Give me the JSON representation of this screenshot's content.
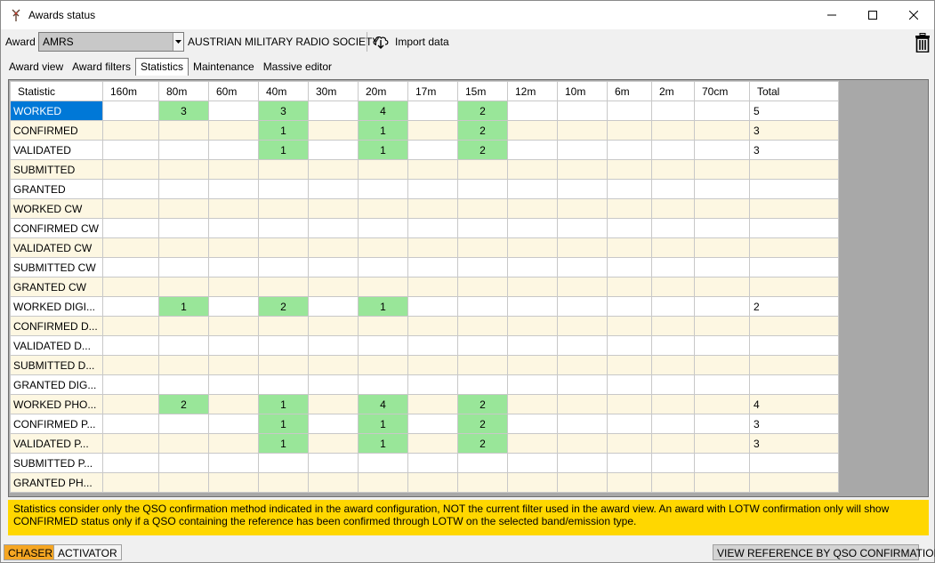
{
  "window": {
    "title": "Awards status"
  },
  "award": {
    "label": "Award",
    "selected": "AMRS",
    "name": "AUSTRIAN MILITARY RADIO SOCIETY",
    "import_label": "Import data"
  },
  "tabs": [
    {
      "label": "Award view"
    },
    {
      "label": "Award filters"
    },
    {
      "label": "Statistics",
      "active": true
    },
    {
      "label": "Maintenance"
    },
    {
      "label": "Massive editor"
    }
  ],
  "grid": {
    "columns": [
      "Statistic",
      "160m",
      "80m",
      "60m",
      "40m",
      "30m",
      "20m",
      "17m",
      "15m",
      "12m",
      "10m",
      "6m",
      "2m",
      "70cm",
      "Total"
    ],
    "rows": [
      {
        "label": "WORKED",
        "values": [
          "",
          "3",
          "",
          "3",
          "",
          "4",
          "",
          "2",
          "",
          "",
          "",
          "",
          ""
        ],
        "total": "5"
      },
      {
        "label": "CONFIRMED",
        "values": [
          "",
          "",
          "",
          "1",
          "",
          "1",
          "",
          "2",
          "",
          "",
          "",
          "",
          ""
        ],
        "total": "3"
      },
      {
        "label": "VALIDATED",
        "values": [
          "",
          "",
          "",
          "1",
          "",
          "1",
          "",
          "2",
          "",
          "",
          "",
          "",
          ""
        ],
        "total": "3"
      },
      {
        "label": "SUBMITTED",
        "values": [
          "",
          "",
          "",
          "",
          "",
          "",
          "",
          "",
          "",
          "",
          "",
          "",
          ""
        ],
        "total": ""
      },
      {
        "label": "GRANTED",
        "values": [
          "",
          "",
          "",
          "",
          "",
          "",
          "",
          "",
          "",
          "",
          "",
          "",
          ""
        ],
        "total": ""
      },
      {
        "label": "WORKED CW",
        "values": [
          "",
          "",
          "",
          "",
          "",
          "",
          "",
          "",
          "",
          "",
          "",
          "",
          ""
        ],
        "total": ""
      },
      {
        "label": "CONFIRMED CW",
        "values": [
          "",
          "",
          "",
          "",
          "",
          "",
          "",
          "",
          "",
          "",
          "",
          "",
          ""
        ],
        "total": ""
      },
      {
        "label": "VALIDATED CW",
        "values": [
          "",
          "",
          "",
          "",
          "",
          "",
          "",
          "",
          "",
          "",
          "",
          "",
          ""
        ],
        "total": ""
      },
      {
        "label": "SUBMITTED CW",
        "values": [
          "",
          "",
          "",
          "",
          "",
          "",
          "",
          "",
          "",
          "",
          "",
          "",
          ""
        ],
        "total": ""
      },
      {
        "label": "GRANTED CW",
        "values": [
          "",
          "",
          "",
          "",
          "",
          "",
          "",
          "",
          "",
          "",
          "",
          "",
          ""
        ],
        "total": ""
      },
      {
        "label": "WORKED DIGI...",
        "values": [
          "",
          "1",
          "",
          "2",
          "",
          "1",
          "",
          "",
          "",
          "",
          "",
          "",
          ""
        ],
        "total": "2"
      },
      {
        "label": "CONFIRMED D...",
        "values": [
          "",
          "",
          "",
          "",
          "",
          "",
          "",
          "",
          "",
          "",
          "",
          "",
          ""
        ],
        "total": ""
      },
      {
        "label": "VALIDATED D...",
        "values": [
          "",
          "",
          "",
          "",
          "",
          "",
          "",
          "",
          "",
          "",
          "",
          "",
          ""
        ],
        "total": ""
      },
      {
        "label": "SUBMITTED D...",
        "values": [
          "",
          "",
          "",
          "",
          "",
          "",
          "",
          "",
          "",
          "",
          "",
          "",
          ""
        ],
        "total": ""
      },
      {
        "label": "GRANTED DIG...",
        "values": [
          "",
          "",
          "",
          "",
          "",
          "",
          "",
          "",
          "",
          "",
          "",
          "",
          ""
        ],
        "total": ""
      },
      {
        "label": "WORKED PHO...",
        "values": [
          "",
          "2",
          "",
          "1",
          "",
          "4",
          "",
          "2",
          "",
          "",
          "",
          "",
          ""
        ],
        "total": "4"
      },
      {
        "label": "CONFIRMED P...",
        "values": [
          "",
          "",
          "",
          "1",
          "",
          "1",
          "",
          "2",
          "",
          "",
          "",
          "",
          ""
        ],
        "total": "3"
      },
      {
        "label": "VALIDATED P...",
        "values": [
          "",
          "",
          "",
          "1",
          "",
          "1",
          "",
          "2",
          "",
          "",
          "",
          "",
          ""
        ],
        "total": "3"
      },
      {
        "label": "SUBMITTED P...",
        "values": [
          "",
          "",
          "",
          "",
          "",
          "",
          "",
          "",
          "",
          "",
          "",
          "",
          ""
        ],
        "total": ""
      },
      {
        "label": "GRANTED PH...",
        "values": [
          "",
          "",
          "",
          "",
          "",
          "",
          "",
          "",
          "",
          "",
          "",
          "",
          ""
        ],
        "total": ""
      }
    ],
    "selected_row": 0
  },
  "info": {
    "text": "Statistics consider only the QSO confirmation method indicated in the award configuration, NOT the current filter used in the award view. An award with LOTW confirmation only will show CONFIRMED status only if a QSO containing the reference has been confirmed through LOTW on the selected band/emission type."
  },
  "bottom": {
    "chaser_label": "CHASER",
    "activator_label": "ACTIVATOR",
    "view_ref_label": "VIEW REFERENCE BY QSO CONFIRMATION"
  },
  "colors": {
    "highlight": "#99e699",
    "selected": "#0078d7",
    "alt_row": "#fdf7e2",
    "info_banner": "#ffd700",
    "chaser": "#f5a623"
  },
  "icons": {
    "app": "antenna-icon",
    "import": "cloud-download-icon",
    "delete": "trash-icon"
  }
}
